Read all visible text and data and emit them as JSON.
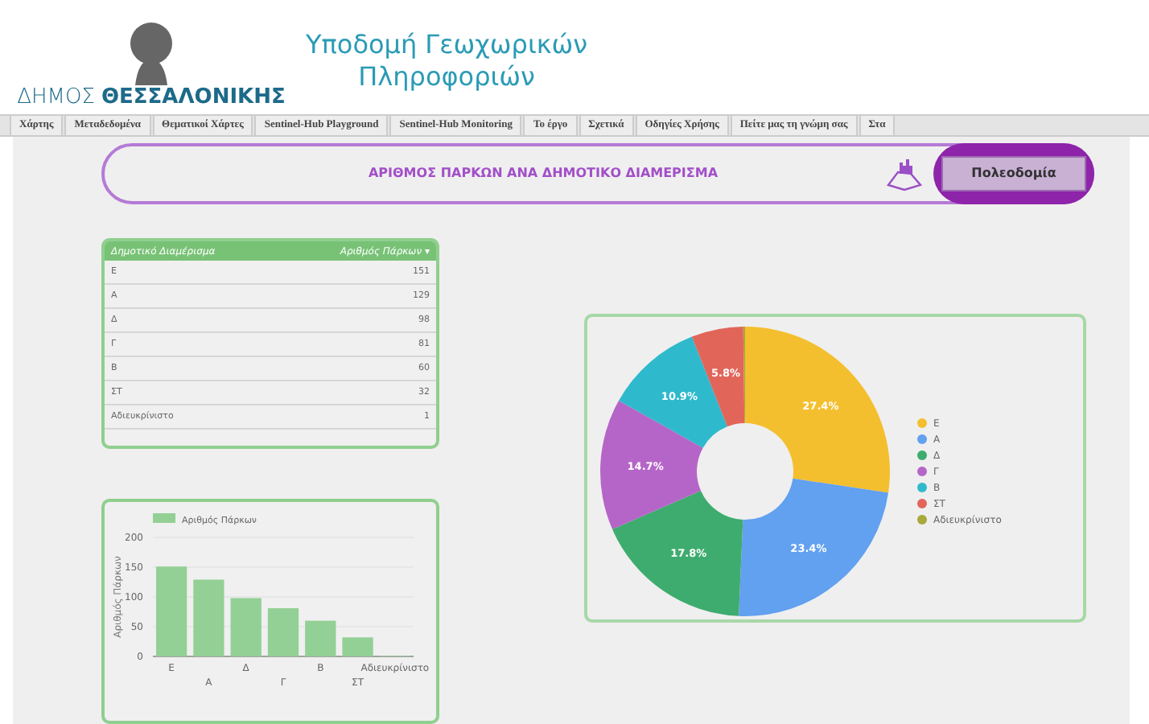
{
  "header": {
    "municipality_prefix": "ΔΗΜΟΣ",
    "municipality_name": "ΘΕΣΣΑΛΟΝΙΚΗΣ",
    "site_title": [
      "Υποδομή Γεωχωρικών",
      "Πληροφοριών"
    ]
  },
  "nav": {
    "items": [
      "Χάρτης",
      "Μεταδεδομένα",
      "Θεματικοί Χάρτες",
      "Sentinel-Hub Playground",
      "Sentinel-Hub Monitoring",
      "Το έργο",
      "Σχετικά",
      "Οδηγίες Χρήσης",
      "Πείτε μας τη γνώμη σας",
      "Στα"
    ]
  },
  "banner": {
    "title": "ΑΡΙΘΜΟΣ ΠΑΡΚΩΝ ΑΝΑ ΔΗΜΟΤΙΚΟ ΔΙΑΜΕΡΙΣΜΑ",
    "button": "Πολεοδομία"
  },
  "table": {
    "columns": [
      "Δημοτικό Διαμέρισμα",
      "Αριθμός Πάρκων"
    ],
    "sort_indicator": "▾",
    "rows": [
      [
        "Ε",
        "151"
      ],
      [
        "Α",
        "129"
      ],
      [
        "Δ",
        "98"
      ],
      [
        "Γ",
        "81"
      ],
      [
        "Β",
        "60"
      ],
      [
        "ΣΤ",
        "32"
      ],
      [
        "Αδιευκρίνιστο",
        "1"
      ]
    ]
  },
  "bar_chart": {
    "chart_data": {
      "type": "bar",
      "ylabel": "Αριθμός Πάρκων",
      "categories": [
        "Ε",
        "Α",
        "Δ",
        "Γ",
        "Β",
        "ΣΤ",
        "Αδιευκρίνιστο"
      ],
      "series": [
        {
          "name": "Αριθμός Πάρκων",
          "color": "#93d095",
          "values": [
            151,
            129,
            98,
            81,
            60,
            32,
            1
          ]
        }
      ],
      "ylim": [
        0,
        200
      ],
      "yticks": [
        0,
        50,
        100,
        150,
        200
      ],
      "grid": true
    }
  },
  "pie_chart": {
    "chart_data": {
      "type": "donut",
      "categories": [
        "Ε",
        "Α",
        "Δ",
        "Γ",
        "Β",
        "ΣΤ",
        "Αδιευκρίνιστο"
      ],
      "series": [
        {
          "values": [
            27.4,
            23.4,
            17.8,
            14.7,
            10.9,
            5.8,
            0.2
          ]
        }
      ],
      "legend": true,
      "value_labels": [
        "27.4%",
        "23.4%",
        "17.8%",
        "14.7%",
        "10.9%",
        "5.8%",
        null
      ],
      "colors": [
        "#f4bf2f",
        "#62a0f0",
        "#3eac6e",
        "#b565c8",
        "#2fb9cc",
        "#e2655a",
        "#a9a83a"
      ]
    }
  }
}
